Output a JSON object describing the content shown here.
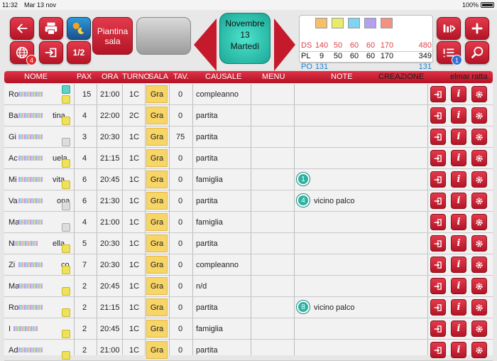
{
  "status": {
    "time": "11:32",
    "date": "Mar 13 nov",
    "battery": "100%"
  },
  "toolbar": {
    "piantina_label": "Piantina sala",
    "half_label": "1/2",
    "globe_badge": "4",
    "list_badge": "1",
    "date": {
      "month": "Novembre",
      "day": "13",
      "weekday": "Martedì"
    }
  },
  "summary": {
    "rows": [
      {
        "label": "DS",
        "values": [
          "140",
          "50",
          "60",
          "60",
          "170"
        ],
        "total": "480",
        "color": "#e0404a"
      },
      {
        "label": "PL",
        "values": [
          "9",
          "50",
          "60",
          "60",
          "170"
        ],
        "total": "349",
        "color": "#111111"
      },
      {
        "label": "PO",
        "values": [
          "131"
        ],
        "total": "131",
        "color": "#1a7fd0"
      }
    ],
    "swatches": [
      "#f5c06a",
      "#e9ec6b",
      "#7fd4f0",
      "#b3a0ee",
      "#f29282"
    ]
  },
  "table": {
    "headers": {
      "nome": "NOME",
      "pax": "PAX",
      "ora": "ORA",
      "turno": "TURNO",
      "sala": "SALA",
      "tav": "TAV.",
      "causale": "CAUSALE",
      "menu": "MENU",
      "note": "NOTE",
      "creazione": "CREAZIONE",
      "user": "elmar ratta"
    },
    "rows": [
      {
        "name": "Ro",
        "pax": "15",
        "ora": "21:00",
        "turno": "1C",
        "sala": "Gra",
        "tav": "0",
        "causale": "compleanno",
        "note_num": "",
        "note": ""
      },
      {
        "name": "Ba",
        "name_end": "tina",
        "pax": "4",
        "ora": "22:00",
        "turno": "2C",
        "sala": "Gra",
        "tav": "0",
        "causale": "partita",
        "note_num": "",
        "note": ""
      },
      {
        "name": "Gi",
        "pax": "3",
        "ora": "20:30",
        "turno": "1C",
        "sala": "Gra",
        "tav": "75",
        "causale": "partita",
        "note_num": "",
        "note": ""
      },
      {
        "name": "Ac",
        "name_end": "uela",
        "pax": "4",
        "ora": "21:15",
        "turno": "1C",
        "sala": "Gra",
        "tav": "0",
        "causale": "partita",
        "note_num": "",
        "note": ""
      },
      {
        "name": "Mi",
        "name_end": "vita",
        "pax": "6",
        "ora": "20:45",
        "turno": "1C",
        "sala": "Gra",
        "tav": "0",
        "causale": "famiglia",
        "note_num": "1",
        "note": ""
      },
      {
        "name": "Va",
        "name_end": "ona",
        "pax": "6",
        "ora": "21:30",
        "turno": "1C",
        "sala": "Gra",
        "tav": "0",
        "causale": "partita",
        "note_num": "4",
        "note": "vicino palco"
      },
      {
        "name": "Ma",
        "pax": "4",
        "ora": "21:00",
        "turno": "1C",
        "sala": "Gra",
        "tav": "0",
        "causale": "famiglia",
        "note_num": "",
        "note": ""
      },
      {
        "name": "N",
        "name_end": "ella",
        "pax": "5",
        "ora": "20:30",
        "turno": "1C",
        "sala": "Gra",
        "tav": "0",
        "causale": "partita",
        "note_num": "",
        "note": ""
      },
      {
        "name": "Zi",
        "name_end": "co",
        "pax": "7",
        "ora": "20:30",
        "turno": "1C",
        "sala": "Gra",
        "tav": "0",
        "causale": "compleanno",
        "note_num": "",
        "note": ""
      },
      {
        "name": "Ma",
        "pax": "2",
        "ora": "20:45",
        "turno": "1C",
        "sala": "Gra",
        "tav": "0",
        "causale": "n/d",
        "note_num": "",
        "note": ""
      },
      {
        "name": "Ro",
        "pax": "2",
        "ora": "21:15",
        "turno": "1C",
        "sala": "Gra",
        "tav": "0",
        "causale": "partita",
        "note_num": "8",
        "note": "vicino palco"
      },
      {
        "name": "I",
        "pax": "2",
        "ora": "20:45",
        "turno": "1C",
        "sala": "Gra",
        "tav": "0",
        "causale": "famiglia",
        "note_num": "",
        "note": ""
      },
      {
        "name": "Ad",
        "pax": "2",
        "ora": "21:00",
        "turno": "1C",
        "sala": "Gra",
        "tav": "0",
        "causale": "partita",
        "note_num": "",
        "note": ""
      }
    ]
  }
}
